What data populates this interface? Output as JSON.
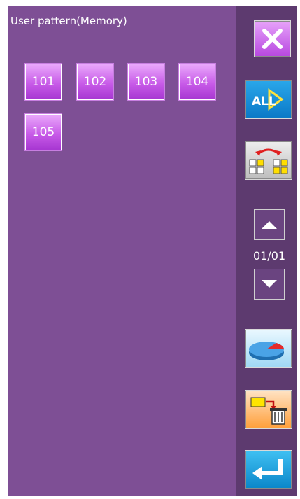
{
  "header": {
    "title": "User pattern(Memory)"
  },
  "patterns": [
    {
      "label": "101"
    },
    {
      "label": "102"
    },
    {
      "label": "103"
    },
    {
      "label": "104"
    },
    {
      "label": "105"
    }
  ],
  "sidebar": {
    "page_indicator": "01/01",
    "all_label": "ALL",
    "icons": [
      "close-icon",
      "select-all-icon",
      "swap-icon",
      "scroll-up-icon",
      "scroll-down-icon",
      "memory-usage-icon",
      "copy-delete-icon",
      "enter-icon"
    ]
  },
  "colors": {
    "background": "#7e4f95",
    "sidebar": "#5d3a6f",
    "pattern_button": "#c85be8"
  }
}
